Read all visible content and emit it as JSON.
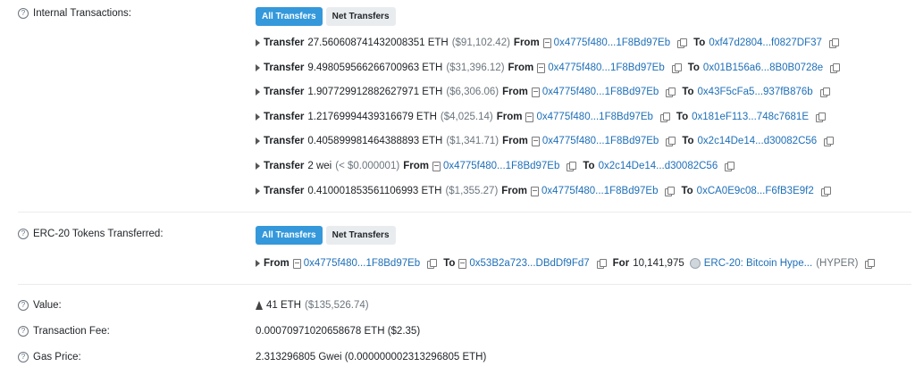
{
  "internal": {
    "label": "Internal Transactions:",
    "tabs": [
      "All Transfers",
      "Net Transfers"
    ],
    "transfers": [
      {
        "prefix": "Transfer",
        "amount": "27.560608741432008351 ETH",
        "usd": "($91,102.42)",
        "from_word": "From",
        "from": "0x4775f480...1F8Bd97Eb",
        "to_word": "To",
        "to": "0xf47d2804...f0827DF37"
      },
      {
        "prefix": "Transfer",
        "amount": "9.498059566266700963 ETH",
        "usd": "($31,396.12)",
        "from_word": "From",
        "from": "0x4775f480...1F8Bd97Eb",
        "to_word": "To",
        "to": "0x01B156a6...8B0B0728e"
      },
      {
        "prefix": "Transfer",
        "amount": "1.907729912882627971 ETH",
        "usd": "($6,306.06)",
        "from_word": "From",
        "from": "0x4775f480...1F8Bd97Eb",
        "to_word": "To",
        "to": "0x43F5cFa5...937fB876b"
      },
      {
        "prefix": "Transfer",
        "amount": "1.21769994439316679 ETH",
        "usd": "($4,025.14)",
        "from_word": "From",
        "from": "0x4775f480...1F8Bd97Eb",
        "to_word": "To",
        "to": "0x181eF113...748c7681E"
      },
      {
        "prefix": "Transfer",
        "amount": "0.405899981464388893 ETH",
        "usd": "($1,341.71)",
        "from_word": "From",
        "from": "0x4775f480...1F8Bd97Eb",
        "to_word": "To",
        "to": "0x2c14De14...d30082C56"
      },
      {
        "prefix": "Transfer",
        "amount": "2 wei",
        "usd": "(< $0.000001)",
        "from_word": "From",
        "from": "0x4775f480...1F8Bd97Eb",
        "to_word": "To",
        "to": "0x2c14De14...d30082C56"
      },
      {
        "prefix": "Transfer",
        "amount": "0.410001853561106993 ETH",
        "usd": "($1,355.27)",
        "from_word": "From",
        "from": "0x4775f480...1F8Bd97Eb",
        "to_word": "To",
        "to": "0xCA0E9c08...F6fB3E9f2"
      }
    ]
  },
  "erc20": {
    "label": "ERC-20 Tokens Transferred:",
    "tabs": [
      "All Transfers",
      "Net Transfers"
    ],
    "from_word": "From",
    "from": "0x4775f480...1F8Bd97Eb",
    "to_word": "To",
    "to": "0x53B2a723...DBdDf9Fd7",
    "for_word": "For",
    "amount": "10,141,975",
    "token": "ERC-20: Bitcoin Hype...",
    "symbol": "(HYPER)"
  },
  "value": {
    "label": "Value:",
    "eth": "41 ETH",
    "usd": "($135,526.74)"
  },
  "fee": {
    "label": "Transaction Fee:",
    "value": "0.00070971020658678 ETH ($2.35)"
  },
  "gas": {
    "label": "Gas Price:",
    "value": "2.313296805 Gwei (0.000000002313296805 ETH)"
  }
}
